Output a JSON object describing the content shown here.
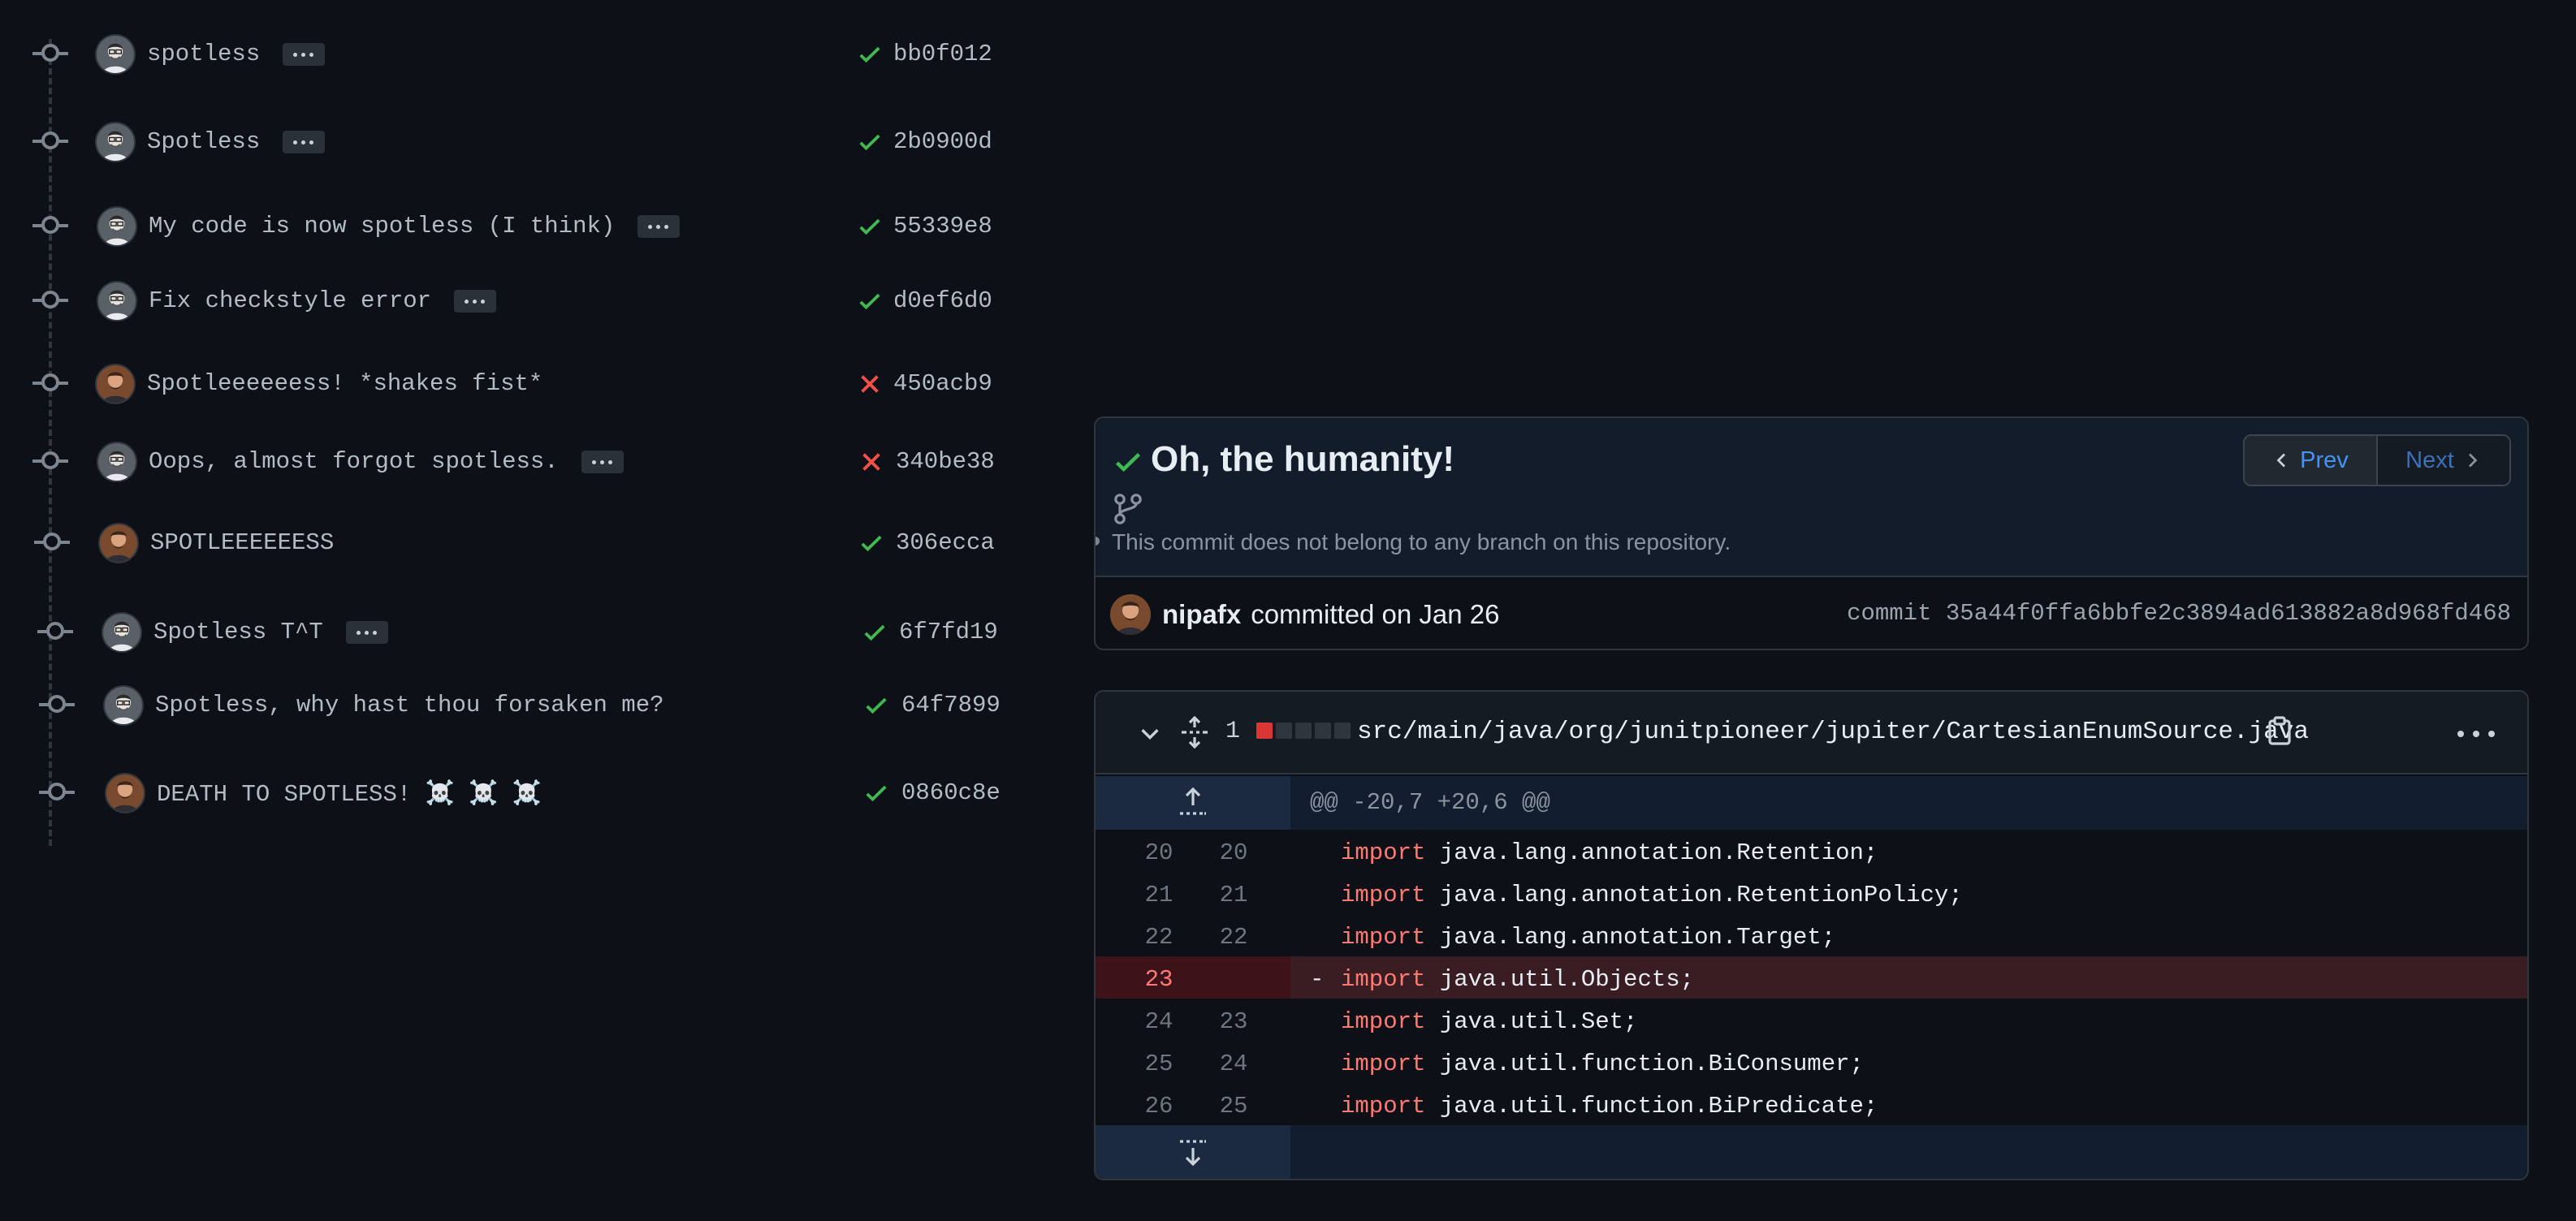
{
  "commits": [
    {
      "message": "spotless",
      "sha": "bb0f012",
      "status": "success",
      "author": "gray",
      "ellipsis": true
    },
    {
      "message": "Spotless",
      "sha": "2b0900d",
      "status": "success",
      "author": "gray",
      "ellipsis": true
    },
    {
      "message": "My code is now spotless (I think)",
      "sha": "55339e8",
      "status": "success",
      "author": "gray",
      "ellipsis": true
    },
    {
      "message": "Fix checkstyle error",
      "sha": "d0ef6d0",
      "status": "success",
      "author": "gray",
      "ellipsis": true
    },
    {
      "message": "Spotleeeeeess! *shakes fist*",
      "sha": "450acb9",
      "status": "failure",
      "author": "brown",
      "ellipsis": false
    },
    {
      "message": "Oops, almost forgot spotless.",
      "sha": "340be38",
      "status": "failure",
      "author": "gray",
      "ellipsis": true
    },
    {
      "message": "SPOTLEEEEEESS",
      "sha": "306ecca",
      "status": "success",
      "author": "brown",
      "ellipsis": false
    },
    {
      "message": "Spotless T^T",
      "sha": "6f7fd19",
      "status": "success",
      "author": "gray",
      "ellipsis": true
    },
    {
      "message": "Spotless, why hast thou forsaken me?",
      "sha": "64f7899",
      "status": "success",
      "author": "gray",
      "ellipsis": false
    },
    {
      "message": "DEATH TO SPOTLESS! ☠️ ☠️ ☠️",
      "sha": "0860c8e",
      "status": "success",
      "author": "brown",
      "ellipsis": false
    }
  ],
  "commit_detail": {
    "title": "Oh, the humanity!",
    "branch_note": "This commit does not belong to any branch on this repository.",
    "prev_label": "Prev",
    "next_label": "Next",
    "author": "nipafx",
    "committed_text": "committed on Jan 26",
    "hash_text": "commit 35a44f0ffa6bbfe2c3894ad613882a8d968fd468"
  },
  "diff": {
    "changes": "1",
    "diffstat": [
      "del",
      "neutral",
      "neutral",
      "neutral",
      "neutral"
    ],
    "file_path": "src/main/java/org/junitpioneer/jupiter/CartesianEnumSource.java",
    "hunk_header": "@@ -20,7 +20,6 @@",
    "lines": [
      {
        "old": "20",
        "new": "20",
        "type": "context",
        "sign": "",
        "keyword": "import",
        "rest": " java.lang.annotation.Retention;"
      },
      {
        "old": "21",
        "new": "21",
        "type": "context",
        "sign": "",
        "keyword": "import",
        "rest": " java.lang.annotation.RetentionPolicy;"
      },
      {
        "old": "22",
        "new": "22",
        "type": "context",
        "sign": "",
        "keyword": "import",
        "rest": " java.lang.annotation.Target;"
      },
      {
        "old": "23",
        "new": "",
        "type": "del",
        "sign": "-",
        "keyword": "import",
        "rest": " java.util.Objects;"
      },
      {
        "old": "24",
        "new": "23",
        "type": "context",
        "sign": "",
        "keyword": "import",
        "rest": " java.util.Set;"
      },
      {
        "old": "25",
        "new": "24",
        "type": "context",
        "sign": "",
        "keyword": "import",
        "rest": " java.util.function.BiConsumer;"
      },
      {
        "old": "26",
        "new": "25",
        "type": "context",
        "sign": "",
        "keyword": "import",
        "rest": " java.util.function.BiPredicate;"
      }
    ]
  },
  "colors": {
    "success": "#3fb950",
    "failure": "#f85149",
    "link": "#4493f8",
    "keyword": "#ff7b72",
    "deletion_bg": "#3a1d22"
  },
  "icons": {
    "status_success": "check-icon",
    "status_failure": "x-icon",
    "branch": "git-branch-icon",
    "collapse": "chevron-down-icon",
    "expand": "unfold-icon",
    "copy": "copy-icon",
    "menu": "kebab-icon"
  }
}
